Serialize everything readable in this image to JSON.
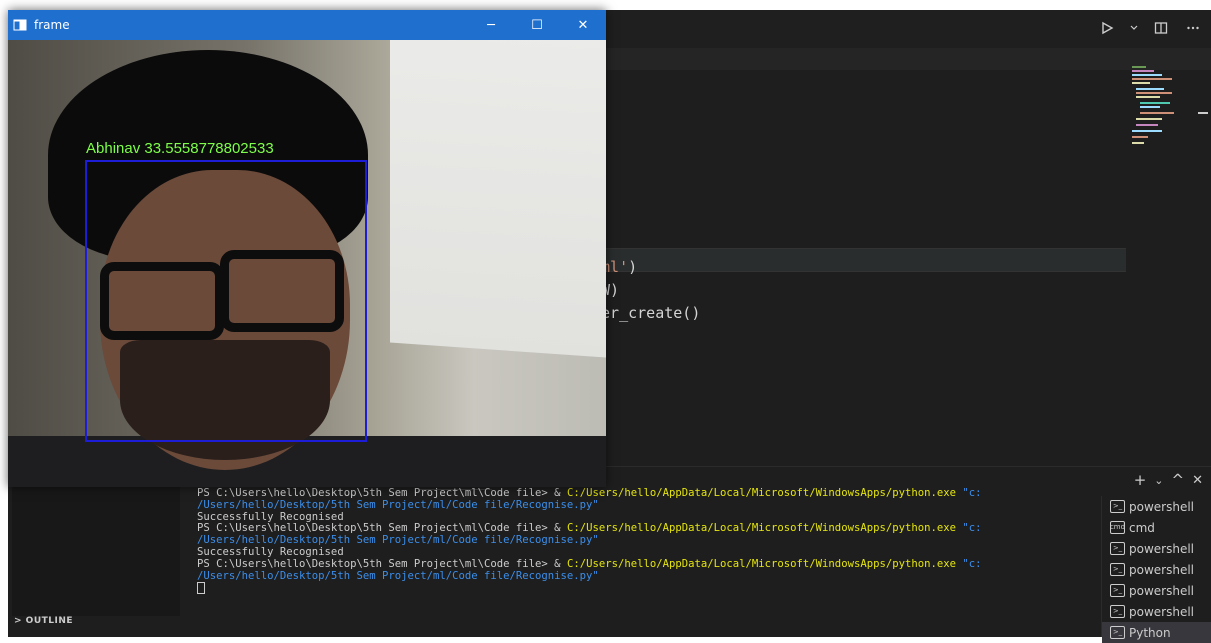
{
  "frame_window": {
    "title": "frame",
    "minimize": "─",
    "maximize": "☐",
    "close": "✕",
    "face_label": "Abhinav 33.5558778802533"
  },
  "editor": {
    "lines": [
      {
        "pre": "",
        "str": "xml'",
        "post": ")"
      },
      {
        "pre": "OW)",
        "str": "",
        "post": ""
      },
      {
        "pre": "zer_create()",
        "str": "",
        "post": ""
      },
      {
        "pre": ")",
        "str": "",
        "post": ""
      }
    ]
  },
  "titlebar": {
    "run_icon": "play-icon",
    "split_icon": "split-editor-icon",
    "more_icon": "ellipsis-icon"
  },
  "panel": {
    "outline_label": "> OUTLINE",
    "actions": {
      "add": "+",
      "dropdown": "⌄",
      "maximize": "^",
      "close": "✕"
    }
  },
  "terminal": {
    "prompt": "PS C:\\Users\\hello\\Desktop\\5th Sem Project\\ml\\Code file> & ",
    "exe": "C:/Users/hello/AppData/Local/Microsoft/WindowsApps/python.exe",
    "arg_part1": " \"c:",
    "arg_part2": "/Users/hello/Desktop/5th Sem Project/ml/Code file/Recognise.py\"",
    "success": "Successfully Recognised"
  },
  "terminal_list": [
    {
      "label": "powershell",
      "icon": ">_"
    },
    {
      "label": "cmd",
      "icon": "cmd"
    },
    {
      "label": "powershell",
      "icon": ">_"
    },
    {
      "label": "powershell",
      "icon": ">_"
    },
    {
      "label": "powershell",
      "icon": ">_"
    },
    {
      "label": "powershell",
      "icon": ">_"
    },
    {
      "label": "Python",
      "icon": ">_"
    }
  ],
  "colors": {
    "window_blue": "#1f6fcf",
    "face_box": "#1d1dd8",
    "label_green": "#7dff4a",
    "exe_yellow": "#e5e510",
    "arg_blue": "#3b8eea"
  }
}
